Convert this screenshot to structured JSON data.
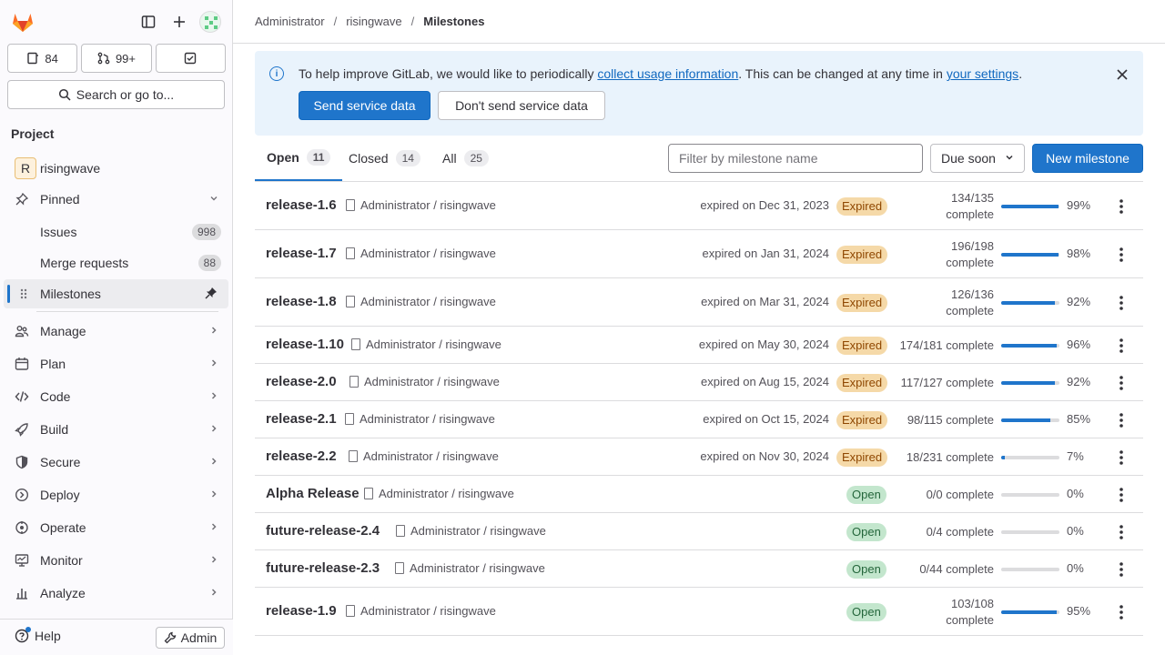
{
  "nav": {
    "counts": [
      {
        "icon": "issues-icon",
        "value": "84"
      },
      {
        "icon": "merge-request-icon",
        "value": "99+"
      },
      {
        "icon": "todo-icon",
        "value": ""
      }
    ],
    "search_label": "Search or go to...",
    "section_title": "Project",
    "project_initial": "R",
    "project_name": "risingwave",
    "pinned_label": "Pinned",
    "pinned_items": [
      {
        "label": "Issues",
        "count": "998"
      },
      {
        "label": "Merge requests",
        "count": "88"
      },
      {
        "label": "Milestones",
        "count": ""
      }
    ],
    "menu": [
      {
        "label": "Manage",
        "icon": "users-icon"
      },
      {
        "label": "Plan",
        "icon": "calendar-icon"
      },
      {
        "label": "Code",
        "icon": "code-icon"
      },
      {
        "label": "Build",
        "icon": "rocket-icon"
      },
      {
        "label": "Secure",
        "icon": "shield-icon"
      },
      {
        "label": "Deploy",
        "icon": "deploy-icon"
      },
      {
        "label": "Operate",
        "icon": "cloud-icon"
      },
      {
        "label": "Monitor",
        "icon": "monitor-icon"
      },
      {
        "label": "Analyze",
        "icon": "chart-icon"
      }
    ],
    "help_label": "Help",
    "admin_label": "Admin"
  },
  "breadcrumb": [
    "Administrator",
    "risingwave",
    "Milestones"
  ],
  "banner": {
    "text_before": "To help improve GitLab, we would like to periodically ",
    "link1": "collect usage information",
    "text_mid": ". This can be changed at any time in ",
    "link2": "your settings",
    "text_after": ".",
    "send_label": "Send service data",
    "dont_send_label": "Don't send service data"
  },
  "tabs": [
    {
      "label": "Open",
      "count": "11"
    },
    {
      "label": "Closed",
      "count": "14"
    },
    {
      "label": "All",
      "count": "25"
    }
  ],
  "filter_placeholder": "Filter by milestone name",
  "sort_label": "Due soon",
  "new_milestone_label": "New milestone",
  "milestones": [
    {
      "title": "release-1.6",
      "project": "Administrator / risingwave",
      "due": "expired on Dec 31, 2023",
      "status": "Expired",
      "complete_line1": "134/135",
      "complete_line2": "complete",
      "progress": 0.99,
      "percent": "99%"
    },
    {
      "title": "release-1.7",
      "project": "Administrator / risingwave",
      "due": "expired on Jan 31, 2024",
      "status": "Expired",
      "complete_line1": "196/198",
      "complete_line2": "complete",
      "progress": 0.98,
      "percent": "98%"
    },
    {
      "title": "release-1.8",
      "project": "Administrator / risingwave",
      "due": "expired on Mar 31, 2024",
      "status": "Expired",
      "complete_line1": "126/136",
      "complete_line2": "complete",
      "progress": 0.92,
      "percent": "92%"
    },
    {
      "title": "release-1.10",
      "project": "Administrator / risingwave",
      "due": "expired on May 30, 2024",
      "status": "Expired",
      "complete_line1": "174/181 complete",
      "complete_line2": "",
      "progress": 0.96,
      "percent": "96%"
    },
    {
      "title": "release-2.0",
      "project": "Administrator / risingwave",
      "due": "expired on Aug 15, 2024",
      "status": "Expired",
      "complete_line1": "117/127 complete",
      "complete_line2": "",
      "progress": 0.92,
      "percent": "92%"
    },
    {
      "title": "release-2.1",
      "project": "Administrator / risingwave",
      "due": "expired on Oct 15, 2024",
      "status": "Expired",
      "complete_line1": "98/115 complete",
      "complete_line2": "",
      "progress": 0.85,
      "percent": "85%"
    },
    {
      "title": "release-2.2",
      "project": "Administrator / risingwave",
      "due": "expired on Nov 30, 2024",
      "status": "Expired",
      "complete_line1": "18/231 complete",
      "complete_line2": "",
      "progress": 0.07,
      "percent": "7%"
    },
    {
      "title": "Alpha Release",
      "project": "Administrator / risingwave",
      "due": "",
      "status": "Open",
      "complete_line1": "0/0 complete",
      "complete_line2": "",
      "progress": 0,
      "percent": "0%"
    },
    {
      "title": "future-release-2.4",
      "project": "Administrator / risingwave",
      "due": "",
      "status": "Open",
      "complete_line1": "0/4 complete",
      "complete_line2": "",
      "progress": 0,
      "percent": "0%"
    },
    {
      "title": "future-release-2.3",
      "project": "Administrator / risingwave",
      "due": "",
      "status": "Open",
      "complete_line1": "0/44 complete",
      "complete_line2": "",
      "progress": 0,
      "percent": "0%"
    },
    {
      "title": "release-1.9",
      "project": "Administrator / risingwave",
      "due": "",
      "status": "Open",
      "complete_line1": "103/108",
      "complete_line2": "complete",
      "progress": 0.95,
      "percent": "95%"
    }
  ],
  "colors": {
    "accent": "#1f75cb",
    "expired_badge": "#f5d9a8",
    "open_badge": "#c3e6cd"
  }
}
